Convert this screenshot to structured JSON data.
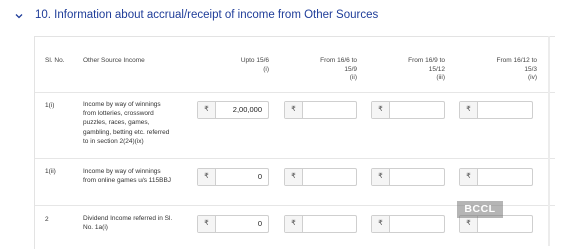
{
  "section": {
    "chevron_icon": "chevron-down-icon",
    "title": "10. Information about accrual/receipt of income from Other Sources"
  },
  "table": {
    "headers": {
      "slno": "Sl. No.",
      "source": "Other Source Income",
      "col1_line1": "Upto 15/6",
      "col1_line2": "(i)",
      "col2_line1": "From 16/6 to",
      "col2_line2": "15/9",
      "col2_line3": "(ii)",
      "col3_line1": "From 16/9 to",
      "col3_line2": "15/12",
      "col3_line3": "(iii)",
      "col4_line1": "From 16/12 to",
      "col4_line2": "15/3",
      "col4_line3": "(iv)"
    },
    "currency_symbol": "₹",
    "rows": [
      {
        "slno": "1(i)",
        "desc": "Income by way of winnings from lotteries, crossword puzzles, races, games, gambling, betting etc. referred to in section 2(24)(ix)",
        "values": [
          "2,00,000",
          "",
          "",
          ""
        ]
      },
      {
        "slno": "1(ii)",
        "desc": "Income by way of winnings from online games u/s 115BBJ",
        "values": [
          "0",
          "",
          "",
          ""
        ]
      },
      {
        "slno": "2",
        "desc": "Dividend Income referred in Sl. No. 1a(i)",
        "values": [
          "0",
          "",
          "",
          ""
        ]
      }
    ]
  },
  "watermark": "BCCL"
}
